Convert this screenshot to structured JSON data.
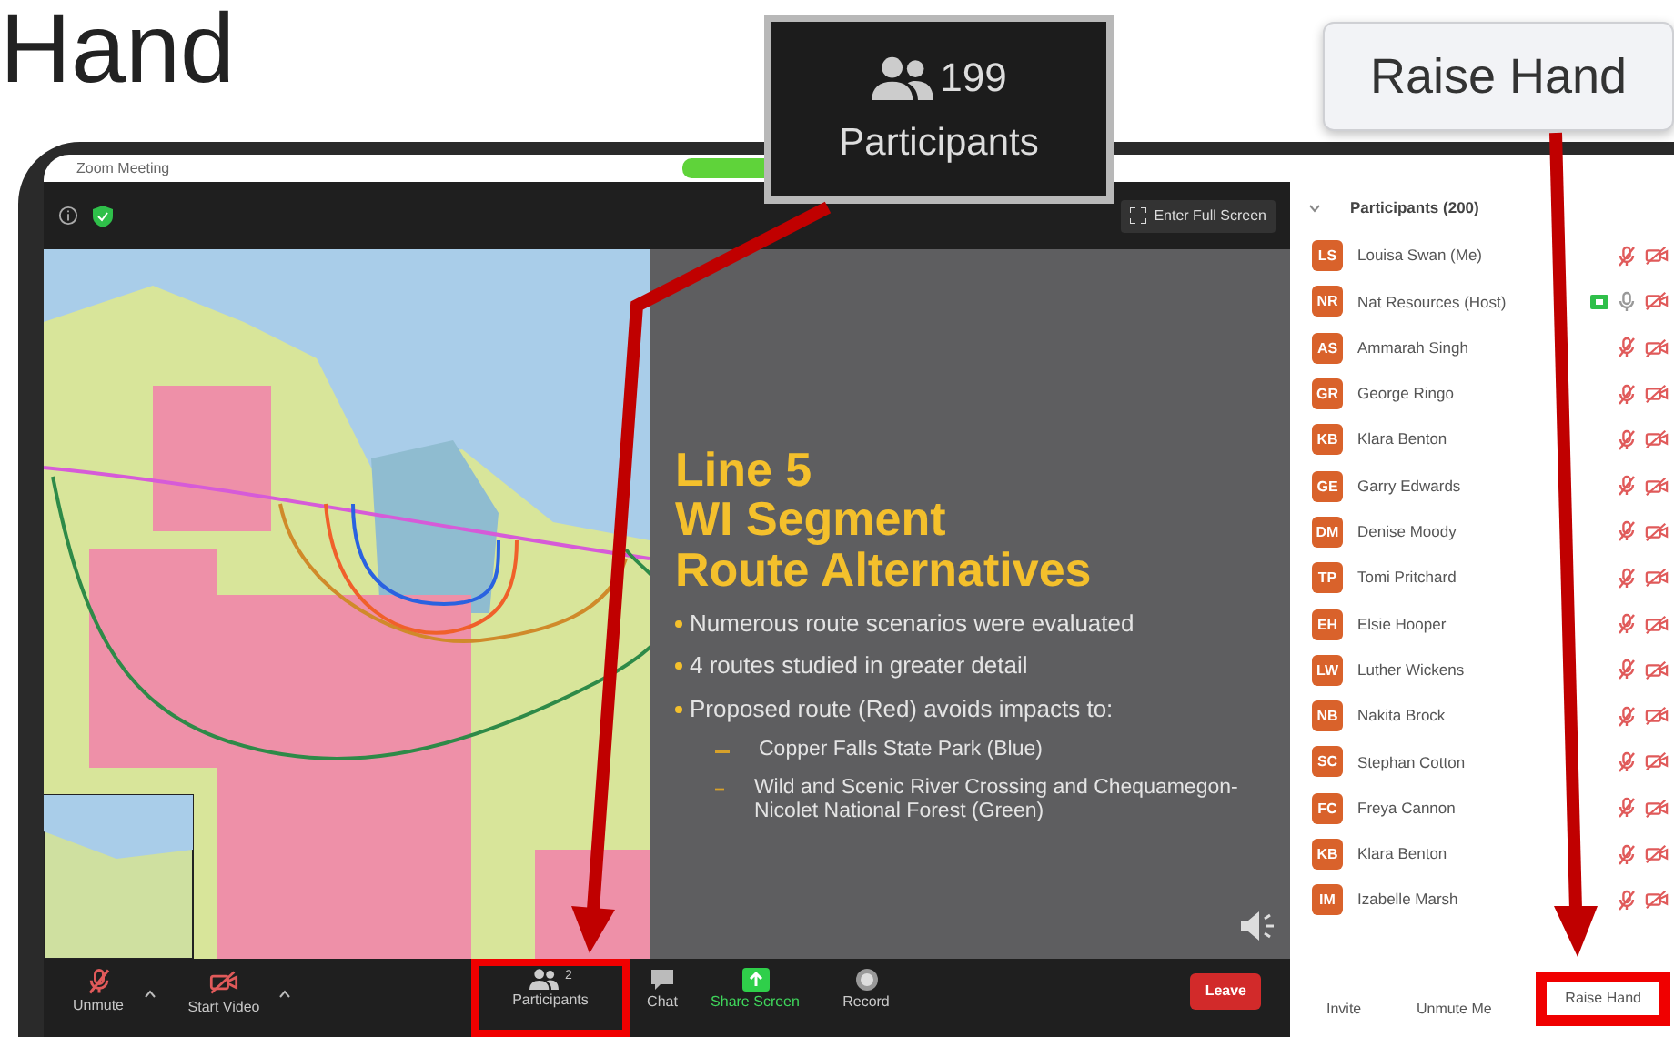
{
  "heading": "Hand",
  "callouts": [
    {
      "kind": "participants",
      "count": "199",
      "label": "Participants"
    },
    {
      "kind": "raise_hand",
      "label": "Raise Hand"
    }
  ],
  "window": {
    "title": "Zoom Meeting",
    "full_screen_button": "Enter Full Screen"
  },
  "slide": {
    "title_lines": [
      "Line 5",
      "WI Segment",
      "Route Alternatives"
    ],
    "bullets": [
      {
        "kind": "bullet",
        "text": "Numerous route scenarios were evaluated"
      },
      {
        "kind": "bullet",
        "text": "4 routes studied in greater detail"
      },
      {
        "kind": "bullet",
        "text": "Proposed route (Red) avoids impacts to:"
      },
      {
        "kind": "sub",
        "text": "Copper Falls State Park (Blue)"
      },
      {
        "kind": "sub",
        "text": "Wild and Scenic River Crossing and Chequamegon-Nicolet National Forest (Green)"
      }
    ]
  },
  "toolbar": [
    {
      "kind": "mic",
      "label": "Unmute",
      "muted": true,
      "highlighted": false
    },
    {
      "kind": "video",
      "label": "Start Video",
      "muted": true,
      "highlighted": false
    },
    {
      "kind": "participants",
      "label": "Participants",
      "count": "2",
      "highlighted": true
    },
    {
      "kind": "chat",
      "label": "Chat",
      "highlighted": false
    },
    {
      "kind": "share",
      "label": "Share Screen",
      "highlighted": false
    },
    {
      "kind": "record",
      "label": "Record",
      "highlighted": false
    }
  ],
  "leave_button": "Leave",
  "participants": {
    "title": "Participants (200)",
    "list": [
      {
        "initials": "LS",
        "name": "Louisa Swan (Me)",
        "sharing": false,
        "mic_muted": true,
        "video_off": true
      },
      {
        "initials": "NR",
        "name": "Nat Resources (Host)",
        "sharing": true,
        "mic_muted": false,
        "video_off": true
      },
      {
        "initials": "AS",
        "name": "Ammarah Singh",
        "sharing": false,
        "mic_muted": true,
        "video_off": true
      },
      {
        "initials": "GR",
        "name": "George Ringo",
        "sharing": false,
        "mic_muted": true,
        "video_off": true
      },
      {
        "initials": "KB",
        "name": "Klara Benton",
        "sharing": false,
        "mic_muted": true,
        "video_off": true
      },
      {
        "initials": "GE",
        "name": "Garry Edwards",
        "sharing": false,
        "mic_muted": true,
        "video_off": true
      },
      {
        "initials": "DM",
        "name": "Denise Moody",
        "sharing": false,
        "mic_muted": true,
        "video_off": true
      },
      {
        "initials": "TP",
        "name": "Tomi Pritchard",
        "sharing": false,
        "mic_muted": true,
        "video_off": true
      },
      {
        "initials": "EH",
        "name": "Elsie Hooper",
        "sharing": false,
        "mic_muted": true,
        "video_off": true
      },
      {
        "initials": "LW",
        "name": "Luther Wickens",
        "sharing": false,
        "mic_muted": true,
        "video_off": true
      },
      {
        "initials": "NB",
        "name": "Nakita Brock",
        "sharing": false,
        "mic_muted": true,
        "video_off": true
      },
      {
        "initials": "SC",
        "name": "Stephan Cotton",
        "sharing": false,
        "mic_muted": true,
        "video_off": true
      },
      {
        "initials": "FC",
        "name": "Freya Cannon",
        "sharing": false,
        "mic_muted": true,
        "video_off": true
      },
      {
        "initials": "KB",
        "name": "Klara Benton",
        "sharing": false,
        "mic_muted": true,
        "video_off": true
      },
      {
        "initials": "IM",
        "name": "Izabelle Marsh",
        "sharing": false,
        "mic_muted": true,
        "video_off": true
      }
    ],
    "footer": [
      {
        "label": "Invite",
        "highlighted": false
      },
      {
        "label": "Unmute Me",
        "highlighted": false
      },
      {
        "label": "Raise Hand",
        "highlighted": true
      }
    ]
  }
}
